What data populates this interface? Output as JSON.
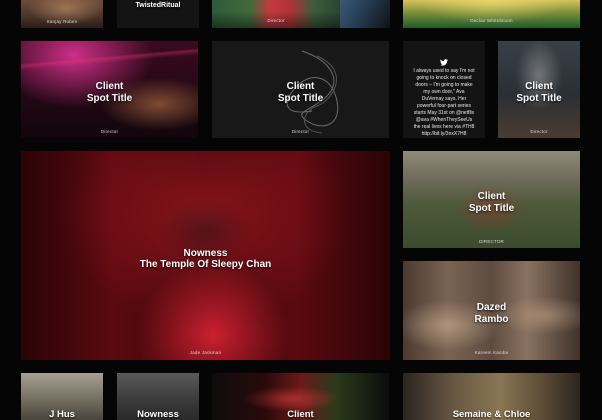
{
  "tiles": {
    "top_1": {
      "sub": "Sanjay Ruben"
    },
    "top_2": {
      "title": "TwistedRitual"
    },
    "top_3": {
      "sub": "Director"
    },
    "top_5": {
      "sub": "Declan Whitebloom"
    },
    "r1_a": {
      "client": "Client",
      "spot": "Spot Title",
      "sub": "Director"
    },
    "r1_b": {
      "client": "Client",
      "spot": "Spot Title",
      "sub": "Director"
    },
    "r1_c": {
      "tweet": "I always used to say I'm not going to knock on closed doors – I'm going to make my own door,\" Ava DuVernay says. Her powerful four-part series starts May 31st on @netflix @ava #WhenTheySeeUs the real lives here via #TH8 http://bit.ly/3nxX7H8",
      "icon": "twitter-icon"
    },
    "r1_d": {
      "client": "Client",
      "spot": "Spot Title",
      "sub": "Director"
    },
    "big": {
      "client": "Nowness",
      "spot": "The Temple Of Sleepy Chan",
      "sub": "Jade Jackman"
    },
    "right_1": {
      "client": "Client",
      "spot": "Spot Title",
      "sub": "DIRECTOR"
    },
    "right_2": {
      "client": "Dazed",
      "spot": "Rambo",
      "sub": "Kareem Kambe"
    },
    "bot_1": {
      "title": "J Hus"
    },
    "bot_2": {
      "title": "Nowness"
    },
    "bot_3": {
      "title": "Client"
    },
    "bot_4": {
      "title": "Semaine & Chloe"
    }
  }
}
